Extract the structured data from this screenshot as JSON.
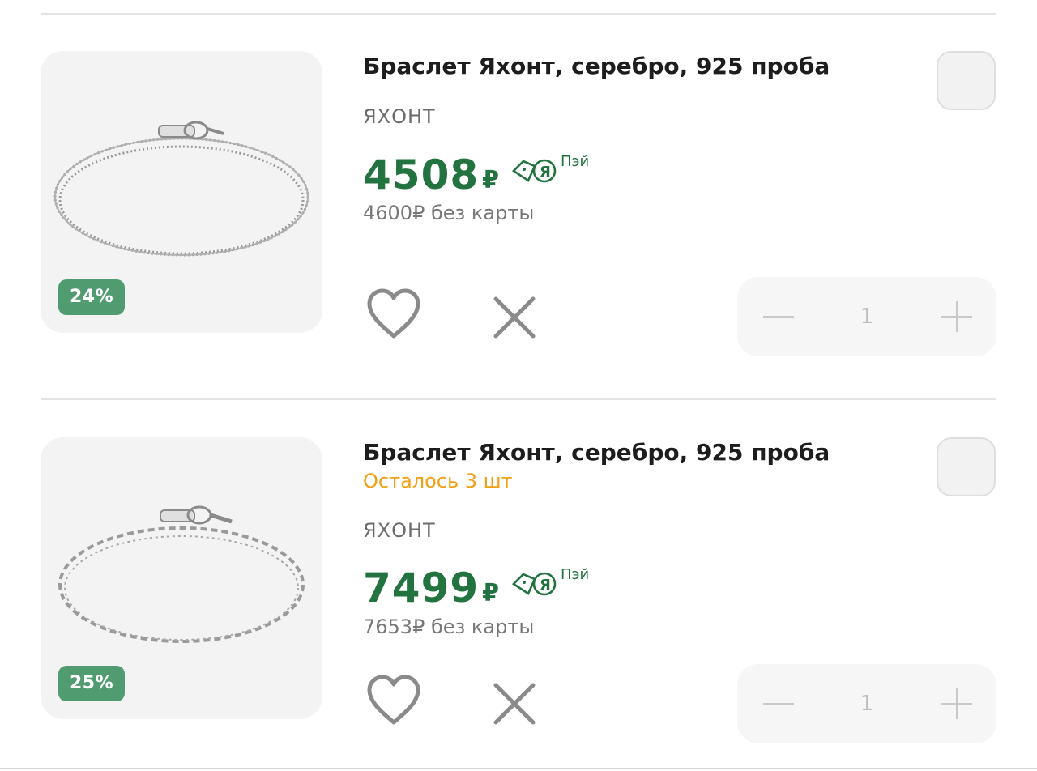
{
  "cart": {
    "items": [
      {
        "title": "Браслет Яхонт, серебро, 925 проба",
        "stock_note": "",
        "brand": "ЯХОНТ",
        "price": "4508",
        "currency": "₽",
        "pay_label": "Пэй",
        "old_price": "4600₽ без карты",
        "discount": "24%",
        "quantity": "1"
      },
      {
        "title": "Браслет Яхонт, серебро, 925 проба",
        "stock_note": "Осталось 3 шт",
        "brand": "ЯХОНТ",
        "price": "7499",
        "currency": "₽",
        "pay_label": "Пэй",
        "old_price": "7653₽ без карты",
        "discount": "25%",
        "quantity": "1"
      }
    ]
  },
  "colors": {
    "price_green": "#22733f",
    "badge_green": "#509b6f",
    "stock_orange": "#f0a012"
  },
  "icons": [
    "bracelet-image",
    "yandex-pay-icon",
    "heart-icon",
    "close-icon",
    "minus-icon",
    "plus-icon",
    "checkbox"
  ]
}
